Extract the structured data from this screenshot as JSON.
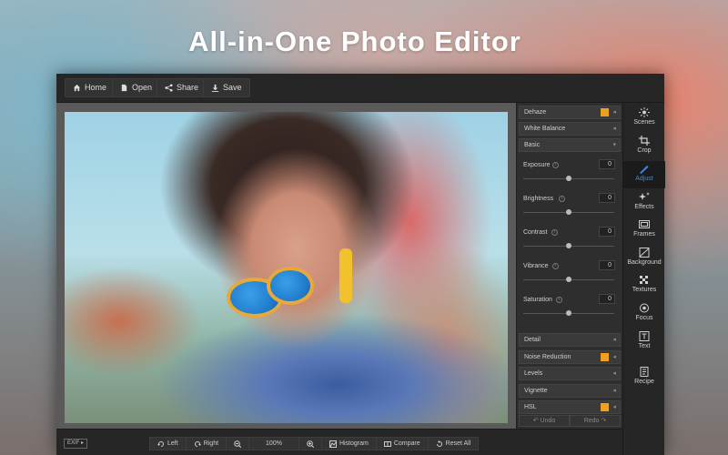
{
  "hero": {
    "title": "All-in-One Photo Editor"
  },
  "toolbar": {
    "home": "Home",
    "open": "Open",
    "share": "Share",
    "save": "Save"
  },
  "panel": {
    "sections_top": [
      "Dehaze",
      "White Balance",
      "Basic"
    ],
    "adjustments": [
      {
        "label": "Exposure",
        "value": "0"
      },
      {
        "label": "Brightness",
        "value": "0"
      },
      {
        "label": "Contrast",
        "value": "0"
      },
      {
        "label": "Vibrance",
        "value": "0"
      },
      {
        "label": "Saturation",
        "value": "0"
      }
    ],
    "sections_bottom": [
      "Detail",
      "Noise Reduction",
      "Levels",
      "Vignette",
      "HSL"
    ],
    "undo": "Undo",
    "redo": "Redo",
    "premium_badge_color": "#f0a020"
  },
  "tools": [
    {
      "label": "Scenes",
      "icon": "scenes-icon"
    },
    {
      "label": "Crop",
      "icon": "crop-icon"
    },
    {
      "label": "Adjust",
      "icon": "adjust-icon",
      "active": true
    },
    {
      "label": "Effects",
      "icon": "effects-icon"
    },
    {
      "label": "Frames",
      "icon": "frames-icon"
    },
    {
      "label": "Background",
      "icon": "background-icon"
    },
    {
      "label": "Textures",
      "icon": "textures-icon"
    },
    {
      "label": "Focus",
      "icon": "focus-icon"
    },
    {
      "label": "Text",
      "icon": "text-icon"
    },
    {
      "label": "Recipe",
      "icon": "recipe-icon"
    }
  ],
  "bottom": {
    "exif": "EXIF",
    "left": "Left",
    "right": "Right",
    "zoom": "100%",
    "histogram": "Histogram",
    "compare": "Compare",
    "reset_all": "Reset All"
  },
  "accent_color": "#3a8fe0"
}
